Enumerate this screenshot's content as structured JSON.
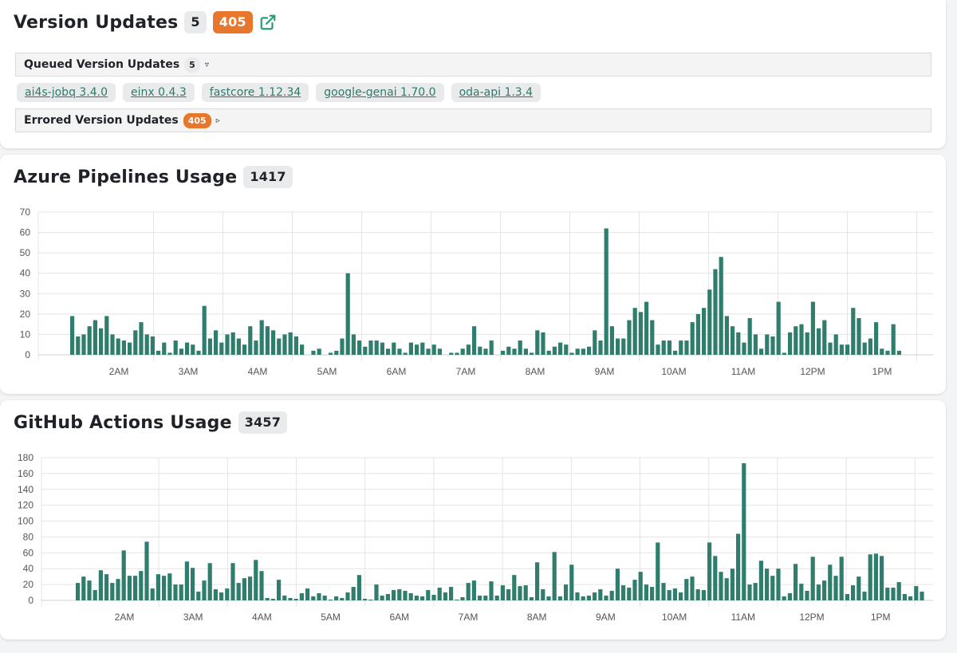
{
  "version_updates": {
    "title": "Version Updates",
    "queued_count": "5",
    "errored_count": "405",
    "external_link_icon": "external-link-icon",
    "queued_section": {
      "label": "Queued Version Updates",
      "count": "5",
      "toggle": "▿"
    },
    "packages": [
      "ai4s-jobq 3.4.0",
      "einx 0.4.3",
      "fastcore 1.12.34",
      "google-genai 1.70.0",
      "oda-api 1.3.4"
    ],
    "errored_section": {
      "label": "Errored Version Updates",
      "count": "405",
      "toggle": "▹"
    }
  },
  "azure": {
    "title": "Azure Pipelines Usage",
    "total": "1417",
    "chart_data": {
      "type": "bar",
      "x_ticks": [
        "2AM",
        "3AM",
        "4AM",
        "5AM",
        "6AM",
        "7AM",
        "8AM",
        "9AM",
        "10AM",
        "11AM",
        "12PM",
        "1PM"
      ],
      "y_ticks": [
        0,
        10,
        20,
        30,
        40,
        50,
        60,
        70
      ],
      "ylim": [
        0,
        70
      ],
      "color": "#2f7d6d",
      "grid": true,
      "values": [
        19,
        9,
        10,
        14,
        17,
        13,
        19,
        10,
        8,
        7,
        6,
        12,
        16,
        10,
        9,
        2,
        6,
        1,
        7,
        3,
        6,
        5,
        2,
        24,
        8,
        12,
        6,
        10,
        11,
        8,
        5,
        14,
        7,
        17,
        14,
        12,
        8,
        10,
        11,
        9,
        5,
        0,
        2,
        3,
        0,
        1,
        2,
        8,
        40,
        10,
        7,
        4,
        7,
        7,
        6,
        3,
        6,
        3,
        1,
        6,
        5,
        6,
        3,
        5,
        3,
        0,
        1,
        1,
        3,
        5,
        14,
        4,
        3,
        7,
        0,
        2,
        4,
        3,
        7,
        3,
        1,
        12,
        11,
        2,
        4,
        6,
        5,
        1,
        3,
        3,
        4,
        12,
        7,
        62,
        14,
        8,
        8,
        17,
        23,
        21,
        26,
        17,
        5,
        7,
        7,
        2,
        7,
        7,
        16,
        20,
        23,
        32,
        42,
        48,
        19,
        14,
        11,
        6,
        18,
        10,
        3,
        10,
        9,
        26,
        1,
        11,
        14,
        15,
        11,
        26,
        13,
        17,
        6,
        10,
        5,
        5,
        23,
        18,
        6,
        8,
        16,
        3,
        2,
        15,
        2
      ],
      "x_start_label_index": 0
    }
  },
  "github": {
    "title": "GitHub Actions Usage",
    "total": "3457",
    "chart_data": {
      "type": "bar",
      "x_ticks": [
        "2AM",
        "3AM",
        "4AM",
        "5AM",
        "6AM",
        "7AM",
        "8AM",
        "9AM",
        "10AM",
        "11AM",
        "12PM",
        "1PM"
      ],
      "y_ticks": [
        0,
        20,
        40,
        60,
        80,
        100,
        120,
        140,
        160,
        180
      ],
      "ylim": [
        0,
        180
      ],
      "color": "#2f7d6d",
      "grid": true,
      "values": [
        22,
        30,
        25,
        13,
        38,
        33,
        22,
        27,
        63,
        31,
        31,
        37,
        74,
        15,
        33,
        31,
        34,
        20,
        20,
        49,
        41,
        11,
        25,
        47,
        14,
        10,
        15,
        47,
        22,
        28,
        30,
        51,
        37,
        3,
        2,
        26,
        6,
        3,
        2,
        9,
        15,
        5,
        9,
        6,
        1,
        5,
        3,
        10,
        17,
        32,
        2,
        1,
        20,
        6,
        8,
        13,
        14,
        12,
        9,
        6,
        5,
        13,
        7,
        16,
        10,
        17,
        1,
        4,
        22,
        25,
        6,
        6,
        24,
        6,
        19,
        14,
        32,
        18,
        19,
        4,
        48,
        14,
        5,
        61,
        5,
        20,
        45,
        10,
        5,
        6,
        10,
        14,
        6,
        12,
        40,
        19,
        16,
        26,
        36,
        20,
        17,
        73,
        22,
        13,
        15,
        10,
        27,
        30,
        14,
        13,
        73,
        56,
        36,
        28,
        40,
        84,
        173,
        20,
        22,
        50,
        40,
        31,
        40,
        5,
        9,
        46,
        21,
        12,
        55,
        20,
        25,
        45,
        31,
        55,
        8,
        19,
        30,
        11,
        58,
        59,
        56,
        16,
        16,
        23,
        8,
        5,
        18,
        11
      ]
    }
  }
}
